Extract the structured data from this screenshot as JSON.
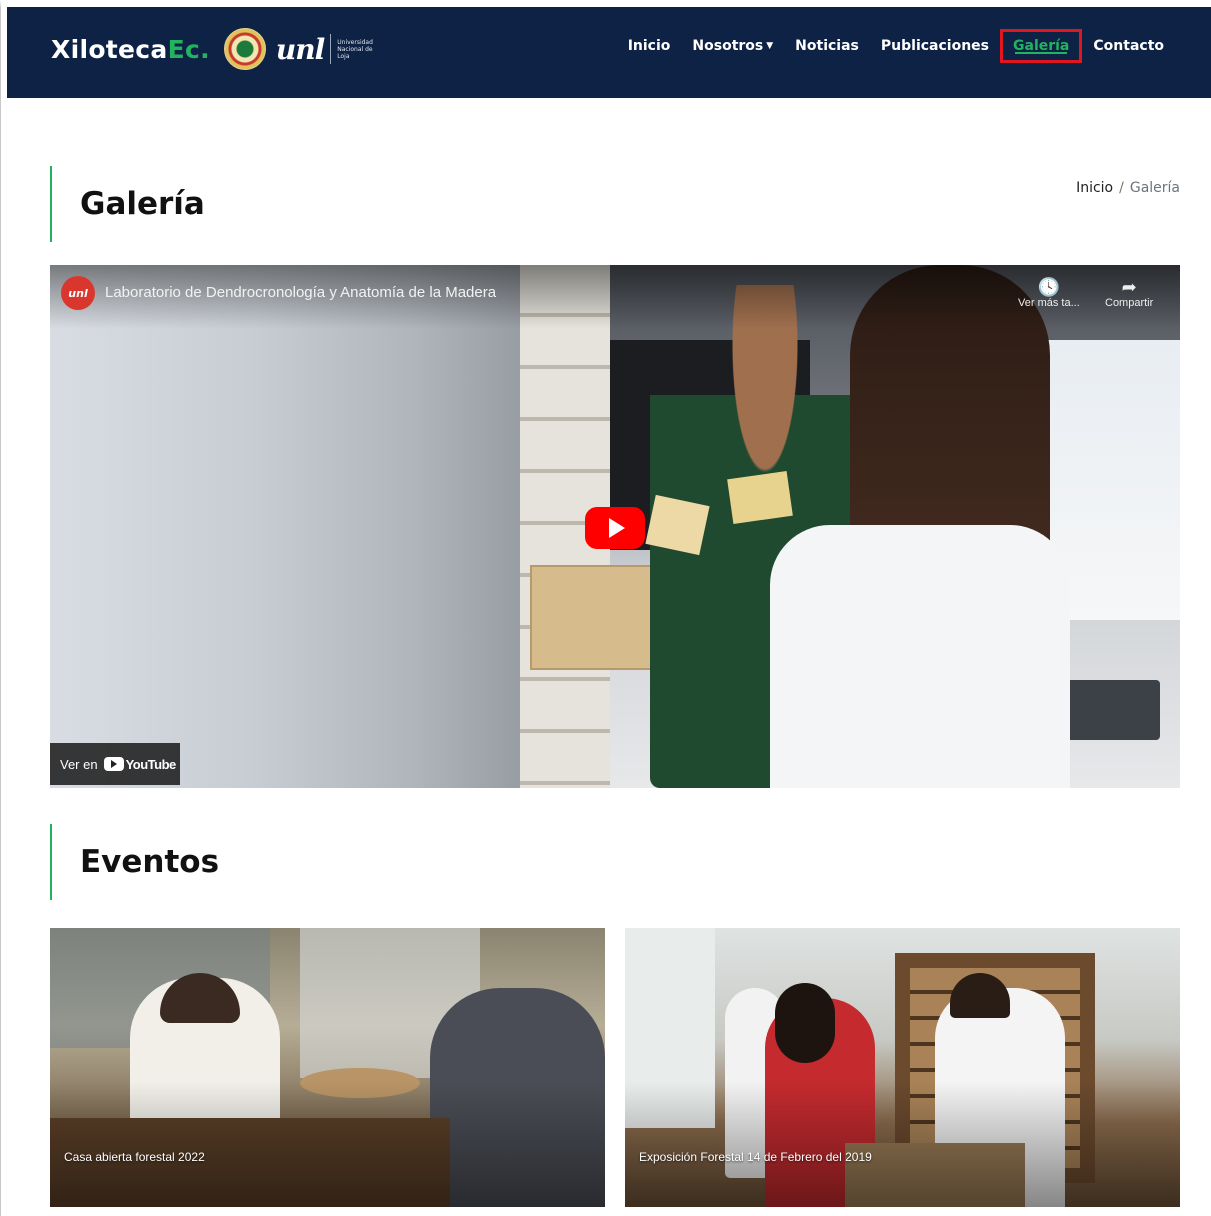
{
  "brand": {
    "name_main": "Xiloteca",
    "name_accent": "Ec.",
    "unl_mark": "unl",
    "unl_text": "Universidad Nacional de Loja"
  },
  "nav": {
    "items": [
      {
        "label": "Inicio"
      },
      {
        "label": "Nosotros",
        "has_caret": true
      },
      {
        "label": "Noticias"
      },
      {
        "label": "Publicaciones"
      },
      {
        "label": "Galería",
        "active": true
      },
      {
        "label": "Contacto"
      }
    ]
  },
  "page": {
    "title": "Galería",
    "breadcrumb": {
      "home": "Inicio",
      "separator": "/",
      "current": "Galería"
    }
  },
  "video": {
    "channel_icon_text": "unl",
    "title": "Laboratorio de Dendrocronología y Anatomía de la Madera",
    "watch_later_label": "Ver más ta...",
    "share_label": "Compartir",
    "watch_on_label": "Ver en",
    "youtube_label": "YouTube"
  },
  "events": {
    "title": "Eventos",
    "cards": [
      {
        "caption": "Casa abierta forestal 2022"
      },
      {
        "caption": "Exposición Forestal 14 de Febrero del 2019"
      }
    ]
  },
  "colors": {
    "navbar_bg": "#0e2245",
    "accent_green": "#22b35e",
    "highlight_red": "#e0171f"
  },
  "icons": [
    "clock-icon",
    "share-icon",
    "play-icon",
    "caret-down-icon"
  ]
}
